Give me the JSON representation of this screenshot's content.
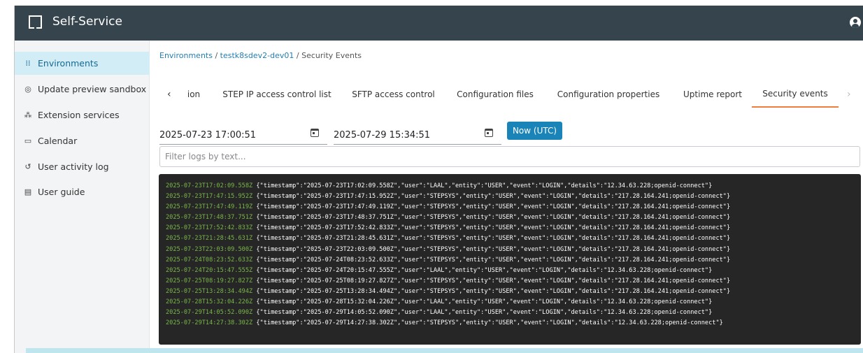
{
  "header": {
    "title": "Self-Service"
  },
  "sidebar": {
    "items": [
      {
        "label": "Environments",
        "icon": "environments-icon",
        "active": true
      },
      {
        "label": "Update preview sandbox",
        "icon": "sandbox-icon",
        "active": false
      },
      {
        "label": "Extension services",
        "icon": "extension-icon",
        "active": false
      },
      {
        "label": "Calendar",
        "icon": "calendar-icon",
        "active": false
      },
      {
        "label": "User activity log",
        "icon": "history-icon",
        "active": false
      },
      {
        "label": "User guide",
        "icon": "book-icon",
        "active": false
      }
    ]
  },
  "breadcrumb": {
    "root": "Environments",
    "env": "testk8sdev2-dev01",
    "current": "Security Events",
    "separator": " / "
  },
  "tabs": {
    "prev_arrow": "‹",
    "next_arrow": "›",
    "items": [
      {
        "label": "ion",
        "active": false
      },
      {
        "label": "STEP IP access control list",
        "active": false
      },
      {
        "label": "SFTP access control",
        "active": false
      },
      {
        "label": "Configuration files",
        "active": false
      },
      {
        "label": "Configuration properties",
        "active": false
      },
      {
        "label": "Uptime report",
        "active": false
      },
      {
        "label": "Security events",
        "active": true
      }
    ]
  },
  "filters": {
    "from": "2025-07-23 17:00:51",
    "to": "2025-07-29 15:34:51",
    "now_button": "Now (UTC)",
    "text_placeholder": "Filter logs by text..."
  },
  "logs": [
    {
      "ts": "2025-07-23T17:02:09.558Z",
      "msg": "{\"timestamp\":\"2025-07-23T17:02:09.558Z\",\"user\":\"LAAL\",\"entity\":\"USER\",\"event\":\"LOGIN\",\"details\":\"12.34.63.228;openid-connect\"}"
    },
    {
      "ts": "2025-07-23T17:47:15.952Z",
      "msg": "{\"timestamp\":\"2025-07-23T17:47:15.952Z\",\"user\":\"STEPSYS\",\"entity\":\"USER\",\"event\":\"LOGIN\",\"details\":\"217.28.164.241;openid-connect\"}"
    },
    {
      "ts": "2025-07-23T17:47:49.119Z",
      "msg": "{\"timestamp\":\"2025-07-23T17:47:49.119Z\",\"user\":\"STEPSYS\",\"entity\":\"USER\",\"event\":\"LOGIN\",\"details\":\"217.28.164.241;openid-connect\"}"
    },
    {
      "ts": "2025-07-23T17:48:37.751Z",
      "msg": "{\"timestamp\":\"2025-07-23T17:48:37.751Z\",\"user\":\"STEPSYS\",\"entity\":\"USER\",\"event\":\"LOGIN\",\"details\":\"217.28.164.241;openid-connect\"}"
    },
    {
      "ts": "2025-07-23T17:52:42.833Z",
      "msg": "{\"timestamp\":\"2025-07-23T17:52:42.833Z\",\"user\":\"STEPSYS\",\"entity\":\"USER\",\"event\":\"LOGIN\",\"details\":\"217.28.164.241;openid-connect\"}"
    },
    {
      "ts": "2025-07-23T21:28:45.631Z",
      "msg": "{\"timestamp\":\"2025-07-23T21:28:45.631Z\",\"user\":\"STEPSYS\",\"entity\":\"USER\",\"event\":\"LOGIN\",\"details\":\"217.28.164.241;openid-connect\"}"
    },
    {
      "ts": "2025-07-23T22:03:09.500Z",
      "msg": "{\"timestamp\":\"2025-07-23T22:03:09.500Z\",\"user\":\"STEPSYS\",\"entity\":\"USER\",\"event\":\"LOGIN\",\"details\":\"217.28.164.241;openid-connect\"}"
    },
    {
      "ts": "2025-07-24T08:23:52.633Z",
      "msg": "{\"timestamp\":\"2025-07-24T08:23:52.633Z\",\"user\":\"STEPSYS\",\"entity\":\"USER\",\"event\":\"LOGIN\",\"details\":\"217.28.164.241;openid-connect\"}"
    },
    {
      "ts": "2025-07-24T20:15:47.555Z",
      "msg": "{\"timestamp\":\"2025-07-24T20:15:47.555Z\",\"user\":\"LAAL\",\"entity\":\"USER\",\"event\":\"LOGIN\",\"details\":\"12.34.63.228;openid-connect\"}"
    },
    {
      "ts": "2025-07-25T08:19:27.827Z",
      "msg": "{\"timestamp\":\"2025-07-25T08:19:27.827Z\",\"user\":\"STEPSYS\",\"entity\":\"USER\",\"event\":\"LOGIN\",\"details\":\"217.28.164.241;openid-connect\"}"
    },
    {
      "ts": "2025-07-25T13:28:34.494Z",
      "msg": "{\"timestamp\":\"2025-07-25T13:28:34.494Z\",\"user\":\"STEPSYS\",\"entity\":\"USER\",\"event\":\"LOGIN\",\"details\":\"217.28.164.241;openid-connect\"}"
    },
    {
      "ts": "2025-07-28T15:32:04.226Z",
      "msg": "{\"timestamp\":\"2025-07-28T15:32:04.226Z\",\"user\":\"LAAL\",\"entity\":\"USER\",\"event\":\"LOGIN\",\"details\":\"12.34.63.228;openid-connect\"}"
    },
    {
      "ts": "2025-07-29T14:05:52.090Z",
      "msg": "{\"timestamp\":\"2025-07-29T14:05:52.090Z\",\"user\":\"LAAL\",\"entity\":\"USER\",\"event\":\"LOGIN\",\"details\":\"12.34.63.228;openid-connect\"}"
    },
    {
      "ts": "2025-07-29T14:27:38.302Z",
      "msg": "{\"timestamp\":\"2025-07-29T14:27:38.302Z\",\"user\":\"STEPSYS\",\"entity\":\"USER\",\"event\":\"LOGIN\",\"details\":\"12.34.63.228;openid-connect\"}"
    }
  ],
  "colors": {
    "topbar": "#36444d",
    "accent": "#1a84b8",
    "active_tab": "#ef7d3c",
    "log_time": "#7ab849"
  }
}
